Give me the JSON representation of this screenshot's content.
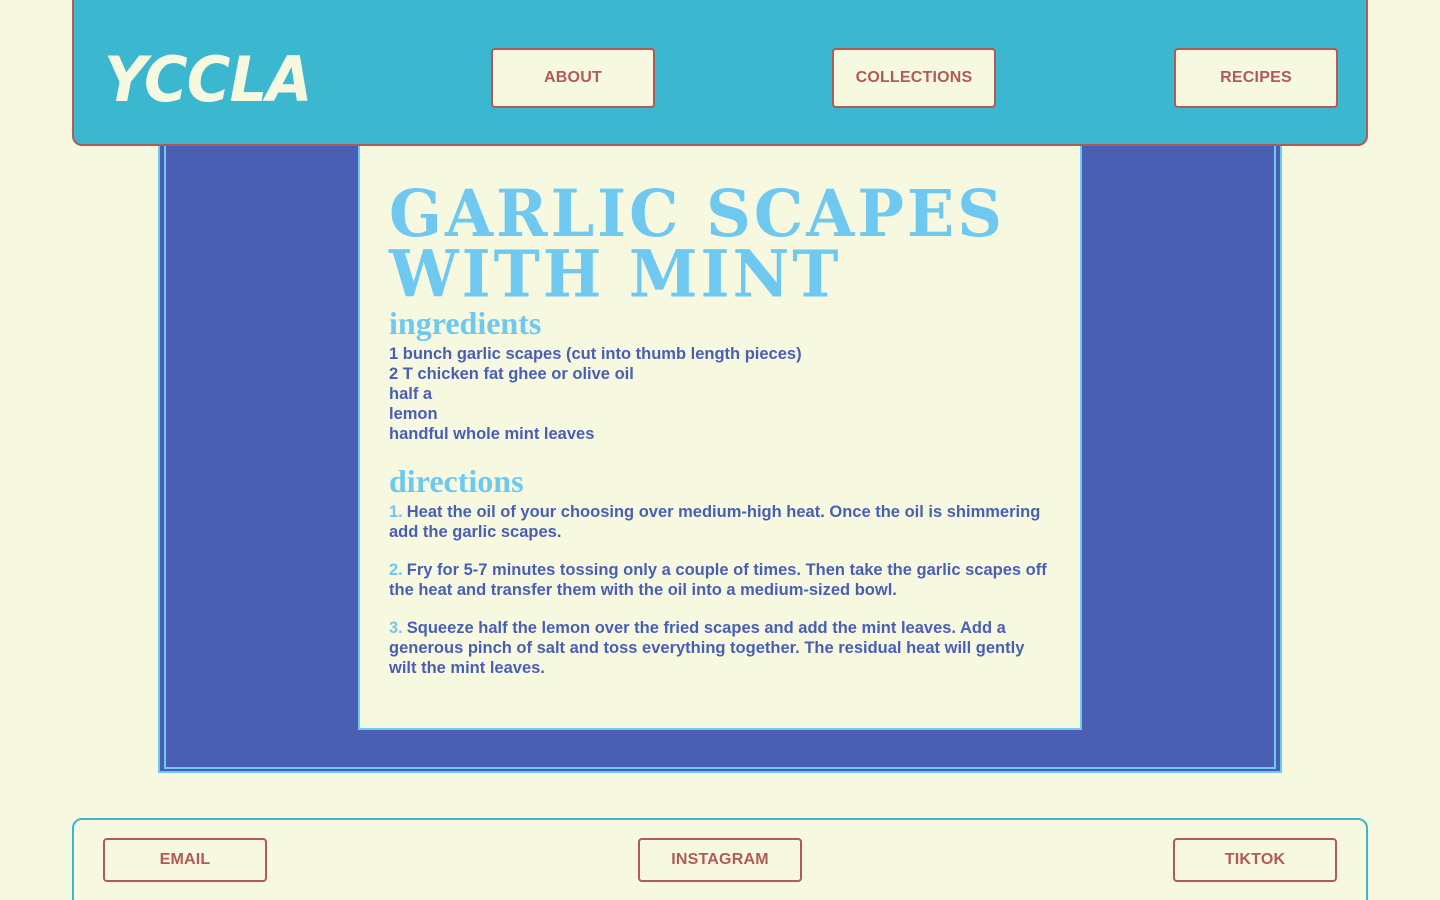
{
  "header": {
    "logo": "YCCLA",
    "nav": {
      "about": "ABOUT",
      "collections": "COLLECTIONS",
      "recipes": "RECIPES"
    }
  },
  "recipe": {
    "title_line1": "GARLIC SCAPES",
    "title_line2": "WITH MINT",
    "ingredients_heading": "ingredients",
    "ingredients": [
      "1 bunch garlic scapes (cut into thumb length pieces)",
      "2 T chicken fat ghee or olive oil",
      "half a",
      "lemon",
      "handful whole mint leaves"
    ],
    "directions_heading": "directions",
    "directions": [
      {
        "num": "1.",
        "text": "Heat the oil of your choosing over medium-high heat. Once the oil is shimmering add the garlic scapes."
      },
      {
        "num": "2.",
        "text": "Fry for 5-7 minutes tossing only a couple of times. Then take the garlic scapes off the heat and transfer them with the oil into a medium-sized bowl."
      },
      {
        "num": "3.",
        "text": "Squeeze half the lemon over the fried scapes and add the mint leaves. Add a generous pinch of salt and toss everything together. The residual heat will gently wilt the mint leaves."
      }
    ]
  },
  "footer": {
    "email": "EMAIL",
    "instagram": "INSTAGRAM",
    "tiktok": "TIKTOK"
  },
  "colors": {
    "background": "#f6f9e0",
    "header": "#3bb8cf",
    "accent_red": "#b25a56",
    "panel_blue": "#485fb4",
    "light_blue": "#6ec8f0"
  }
}
